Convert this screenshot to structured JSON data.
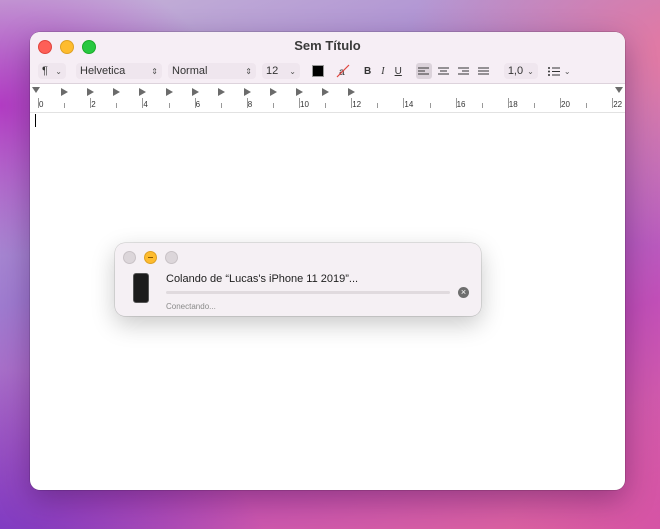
{
  "window": {
    "title": "Sem Título"
  },
  "toolbar": {
    "paragraph_style": "¶",
    "font_family": "Helvetica",
    "font_style": "Normal",
    "font_size": "12",
    "text_color": "#000000",
    "bold_label": "B",
    "italic_label": "I",
    "underline_label": "U",
    "line_spacing": "1,0",
    "active_alignment": "left"
  },
  "ruler": {
    "labels": [
      "0",
      "2",
      "4",
      "6",
      "8",
      "10",
      "12",
      "14",
      "16",
      "18",
      "20",
      "22"
    ]
  },
  "dialog": {
    "title": "Colando de “Lucas's iPhone 11 2019”...",
    "status": "Conectando...",
    "progress": 0
  },
  "colors": {
    "close": "#fe5f57",
    "minimize": "#febc2e",
    "zoom": "#28c840"
  }
}
